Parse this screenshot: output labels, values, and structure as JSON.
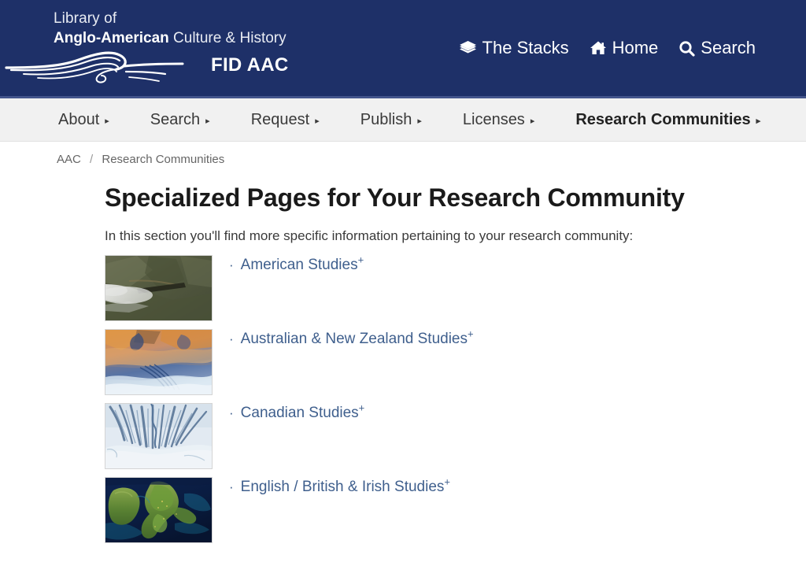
{
  "header": {
    "brand_line1": "Library of",
    "brand_line2_bold": "Anglo-American",
    "brand_line2_rest": " Culture & History",
    "fid_label": "FID AAC",
    "logo_icon": "wave-swirl-logo",
    "background_color": "#1e3068",
    "top_links": [
      {
        "label": "The Stacks",
        "icon": "layers-icon"
      },
      {
        "label": "Home",
        "icon": "home-icon"
      },
      {
        "label": "Search",
        "icon": "search-icon"
      }
    ]
  },
  "nav": {
    "items": [
      {
        "label": "About",
        "has_caret": true,
        "active": false
      },
      {
        "label": "Search",
        "has_caret": true,
        "active": false
      },
      {
        "label": "Request",
        "has_caret": true,
        "active": false
      },
      {
        "label": "Publish",
        "has_caret": true,
        "active": false
      },
      {
        "label": "Licenses",
        "has_caret": true,
        "active": false
      },
      {
        "label": "Research Communities",
        "has_caret": true,
        "active": true
      }
    ],
    "caret_glyph": "▸",
    "background_color": "#f1f1f1"
  },
  "breadcrumb": {
    "root": "AAC",
    "separator": "/",
    "current": "Research Communities"
  },
  "main": {
    "title": "Specialized Pages for Your Research Community",
    "intro": "In this section you'll find more specific information pertaining to your research community:",
    "bullet_glyph": "·",
    "superscript": "+",
    "link_color": "#3f5f8d",
    "communities": [
      {
        "label": "American Studies",
        "thumbnail_name": "satellite-terrain-smoke-plume",
        "thumb_colors": [
          "#5d6247",
          "#7e8466",
          "#3f4634",
          "#ffffff"
        ]
      },
      {
        "label": "Australian & New Zealand Studies",
        "thumbnail_name": "satellite-false-color-desert",
        "thumb_colors": [
          "#d4792f",
          "#e8b06a",
          "#2f4f85",
          "#c8d6e8"
        ]
      },
      {
        "label": "Canadian Studies",
        "thumbnail_name": "satellite-icy-river-delta",
        "thumb_colors": [
          "#dde6ef",
          "#7f9bb8",
          "#345475",
          "#f2f6fa"
        ]
      },
      {
        "label": "English / British & Irish Studies",
        "thumbnail_name": "satellite-british-isles",
        "thumb_colors": [
          "#0d1f4a",
          "#4f7a2c",
          "#8fae4a",
          "#1f6f86"
        ]
      }
    ]
  }
}
